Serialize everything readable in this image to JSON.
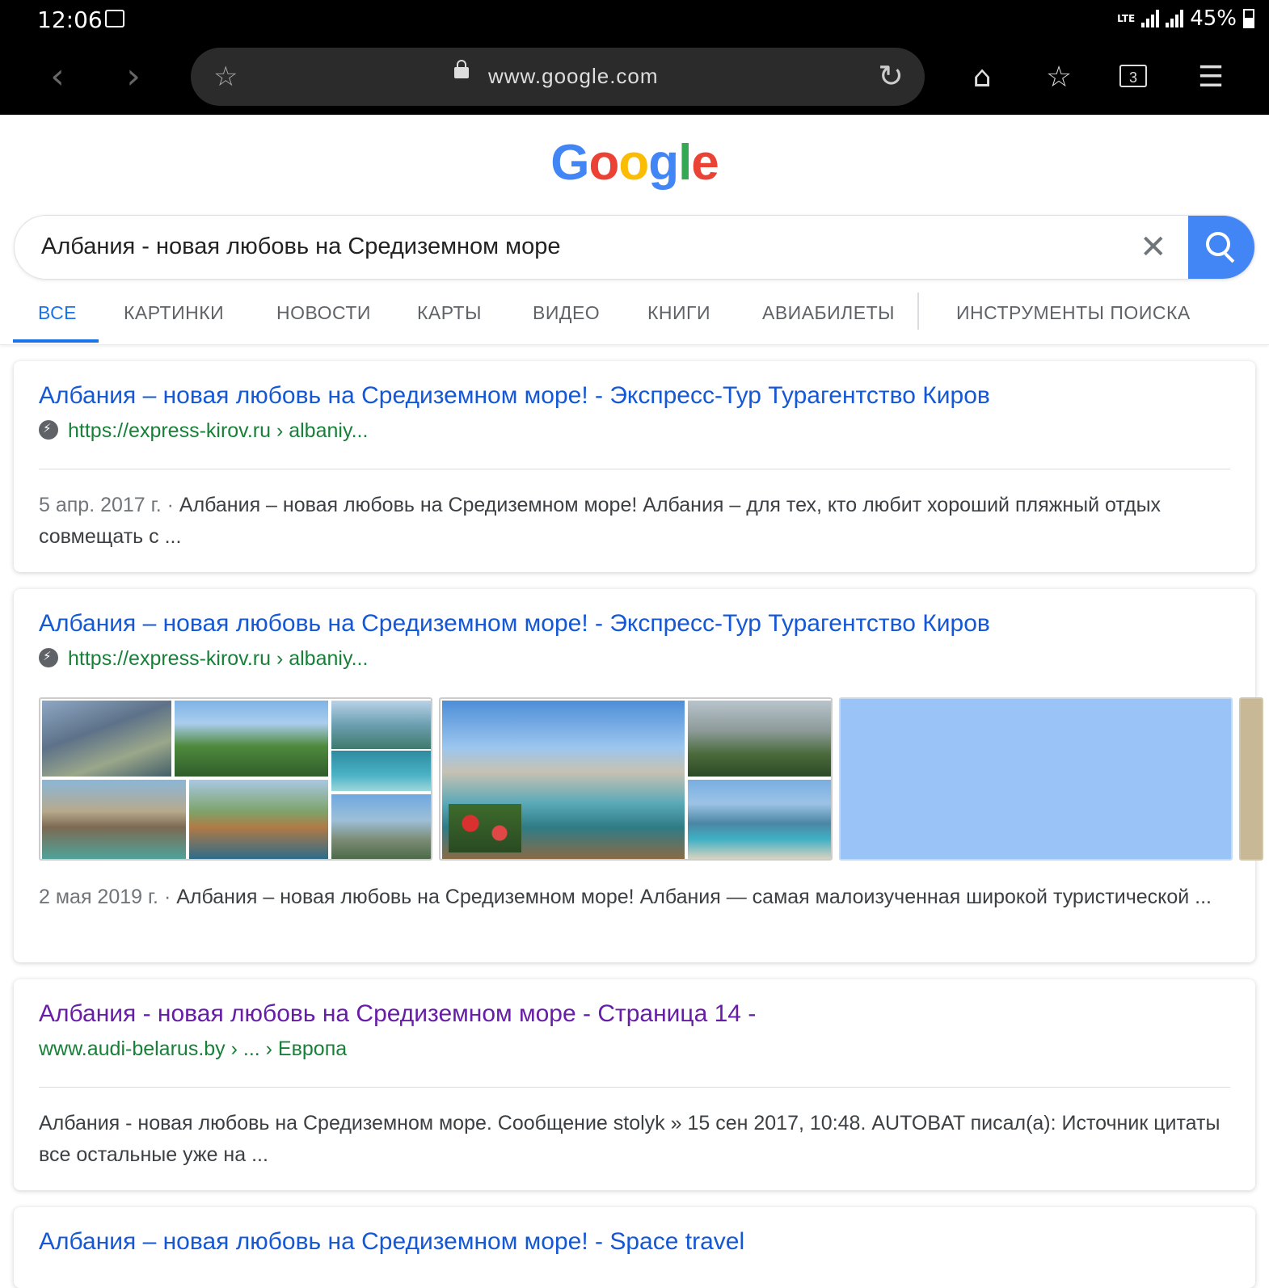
{
  "status_bar": {
    "time": "12:06",
    "network": "LTE",
    "battery": "45%"
  },
  "browser": {
    "url": "www.google.com",
    "open_tabs": "3"
  },
  "logo": [
    "G",
    "o",
    "o",
    "g",
    "l",
    "e"
  ],
  "colors": {
    "logo": [
      "#4285f4",
      "#ea4335",
      "#fbbc05",
      "#4285f4",
      "#34a853",
      "#ea4335"
    ],
    "link": "#1558d6",
    "visited": "#681da8",
    "url": "#188038",
    "accent": "#1a73e8"
  },
  "search": {
    "query": "Албания - новая любовь на Средиземном море"
  },
  "tabs": [
    "ВСЕ",
    "КАРТИНКИ",
    "НОВОСТИ",
    "КАРТЫ",
    "ВИДЕО",
    "КНИГИ",
    "АВИАБИЛЕТЫ",
    "ИНСТРУМЕНТЫ ПОИСКА"
  ],
  "results": [
    {
      "title": "Албания – новая любовь на Средиземном море! - Экспресс-Тур Турагентство Киров",
      "url": "https://express-kirov.ru › albaniy...",
      "date": "5 апр. 2017 г. · ",
      "snippet": "Албания – новая любовь на Средиземном море! Албания – для тех, кто любит хороший пляжный отдых совмещать с ..."
    },
    {
      "title": "Албания – новая любовь на Средиземном море! - Экспресс-Тур Турагентство Киров",
      "url": "https://express-kirov.ru › albaniy...",
      "date": "2 мая 2019 г. · ",
      "snippet": "Албания – новая любовь на Средиземном море! Албания — самая малоизученная широкой туристической ..."
    },
    {
      "title": "Албания - новая любовь на Средиземном море - Страница 14 -",
      "url": "www.audi-belarus.by › ... › Европа",
      "snippet": "Албания - новая любовь на Средиземном море. Сообщение stolyk » 15 сен 2017, 10:48. AUTOBAT писал(а): Источник цитаты все остальные уже на ..."
    },
    {
      "title": "Албания – новая любовь на Средиземном море! - Space travel"
    }
  ]
}
